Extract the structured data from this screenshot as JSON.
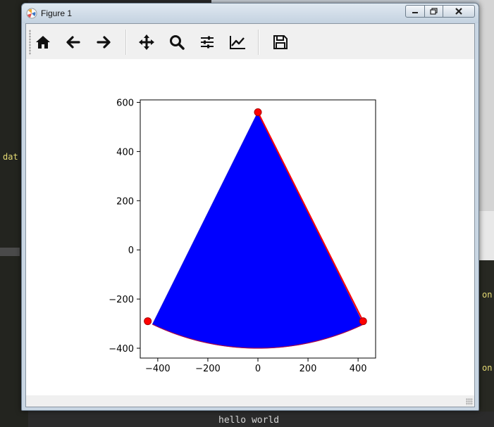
{
  "window": {
    "title": "Figure 1"
  },
  "toolbar": {
    "buttons": [
      {
        "name": "home-button",
        "icon": "home-icon"
      },
      {
        "name": "back-button",
        "icon": "arrow-left-icon"
      },
      {
        "name": "forward-button",
        "icon": "arrow-right-icon"
      },
      {
        "name": "pan-button",
        "icon": "move-icon"
      },
      {
        "name": "zoom-button",
        "icon": "magnifier-icon"
      },
      {
        "name": "subplots-button",
        "icon": "sliders-icon"
      },
      {
        "name": "axes-edit-button",
        "icon": "line-chart-icon"
      },
      {
        "name": "save-button",
        "icon": "floppy-disk-icon"
      }
    ]
  },
  "background": {
    "left_code": "dat",
    "right_code_1": "on",
    "right_code_2": "on",
    "terminal": "hello world"
  },
  "chart_data": {
    "type": "scatter",
    "title": "",
    "xlabel": "",
    "ylabel": "",
    "xlim": [
      -470,
      470
    ],
    "ylim": [
      -440,
      610
    ],
    "xticks": [
      -400,
      -200,
      0,
      200,
      400
    ],
    "yticks": [
      -400,
      -200,
      0,
      200,
      400,
      600
    ],
    "xtick_labels": [
      "−400",
      "−200",
      "0",
      "200",
      "400"
    ],
    "ytick_labels": [
      "−400",
      "−200",
      "0",
      "200",
      "400",
      "600"
    ],
    "grid": false,
    "sector": {
      "apex": [
        0,
        560
      ],
      "radius": 960,
      "start_angle_deg": -116,
      "end_angle_deg": -64,
      "fill_color": "#0000ff"
    },
    "series": [
      {
        "marker": "o",
        "color": "#ff0000",
        "x": [
          0,
          -440,
          420
        ],
        "y": [
          560,
          -290,
          -290
        ]
      }
    ],
    "red_edge": {
      "color": "#ff0000",
      "x": [
        0,
        420
      ],
      "y": [
        560,
        -290
      ]
    }
  }
}
